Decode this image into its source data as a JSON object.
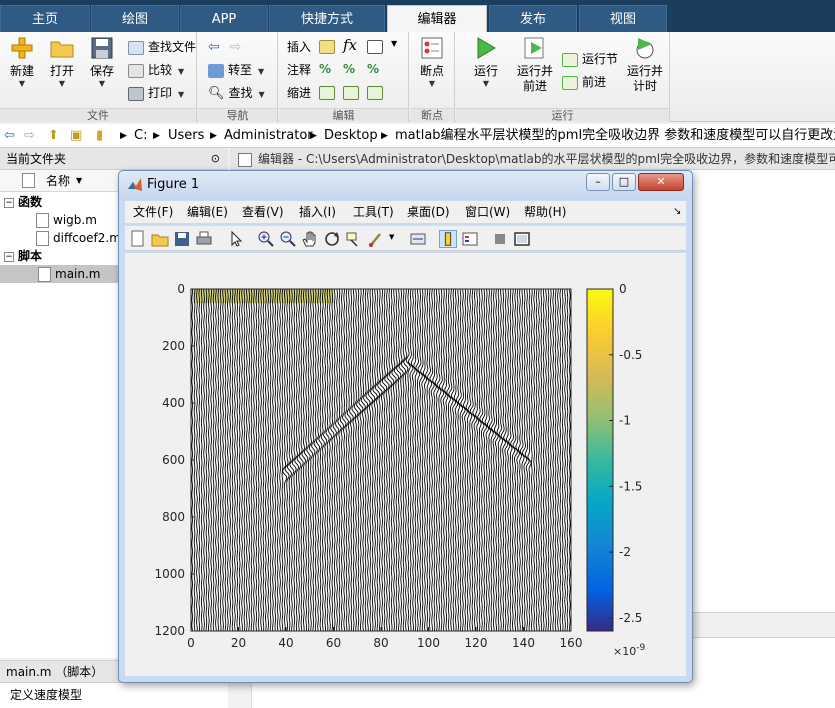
{
  "tabs": [
    {
      "label": "主页",
      "active": false
    },
    {
      "label": "绘图",
      "active": false
    },
    {
      "label": "APP",
      "active": false
    },
    {
      "label": "快捷方式",
      "active": false
    },
    {
      "label": "编辑器",
      "active": true
    },
    {
      "label": "发布",
      "active": false
    },
    {
      "label": "视图",
      "active": false
    }
  ],
  "ribbon": {
    "file": {
      "label": "文件",
      "new": "新建",
      "open": "打开",
      "save": "保存",
      "find_files": "查找文件",
      "compare": "比较",
      "print": "打印"
    },
    "navigate": {
      "label": "导航",
      "goto": "转至",
      "find": "查找"
    },
    "edit": {
      "label": "编辑",
      "insert": "插入",
      "comment": "注释",
      "indent": "缩进",
      "fx": "fx"
    },
    "breakpoints": {
      "label": "断点",
      "breakpoints": "断点"
    },
    "run": {
      "label": "运行",
      "run": "运行",
      "run_advance_1": "运行并",
      "run_advance_2": "前进",
      "run_section": "运行节",
      "advance": "前进",
      "run_time_1": "运行并",
      "run_time_2": "计时"
    }
  },
  "address": {
    "path": [
      "C:",
      "Users",
      "Administrator",
      "Desktop",
      "matlab编程水平层状模型的pml完全吸收边界 参数和速度模型可以自行更改源码程序"
    ]
  },
  "left_panel": {
    "title": "当前文件夹",
    "column_name": "名称",
    "groups": [
      {
        "label": "函数",
        "items": [
          "wigb.m",
          "diffcoef2.m"
        ]
      },
      {
        "label": "脚本",
        "items": [
          "main.m"
        ]
      }
    ],
    "detail_title": "main.m （脚本）",
    "detail_text": "定义速度模型"
  },
  "editor": {
    "header": "编辑器 - C:\\Users\\Administrator\\Desktop\\matlab的水平层状模型的pml完全吸收边界，参数和速度模型可以自行更改源码程序"
  },
  "figure": {
    "title": "Figure 1",
    "menu": [
      "文件(F)",
      "编辑(E)",
      "查看(V)",
      "插入(I)",
      "工具(T)",
      "桌面(D)",
      "窗口(W)",
      "帮助(H)"
    ],
    "min": "–",
    "max": "□",
    "close": "✕"
  },
  "chart_data": {
    "type": "heatmap",
    "title": "",
    "xlabel": "",
    "ylabel": "",
    "xlim": [
      0,
      160
    ],
    "ylim": [
      1200,
      0
    ],
    "x_ticks": [
      0,
      20,
      40,
      60,
      80,
      100,
      120,
      140,
      160
    ],
    "y_ticks": [
      0,
      200,
      400,
      600,
      800,
      1000,
      1200
    ],
    "y_reversed": true,
    "trace_count": 160,
    "wavefront": {
      "apex_x": 92,
      "apex_y": 260,
      "left_end": [
        40,
        650
      ],
      "right_end": [
        143,
        600
      ]
    },
    "colorbar": {
      "ticks": [
        0,
        -0.5,
        -1,
        -1.5,
        -2,
        -2.5
      ],
      "range": [
        -2.6,
        0
      ],
      "exponent_label": "×10",
      "exponent_power": "-9",
      "colormap": "parula"
    },
    "colors": {
      "trace": "#000000",
      "background": "#ffffff",
      "top_tint": "#c8c85a"
    }
  }
}
